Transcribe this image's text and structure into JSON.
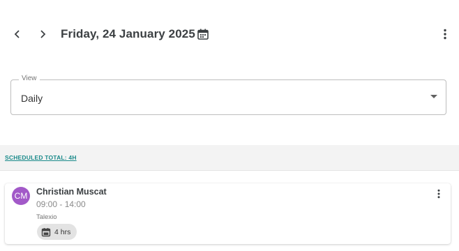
{
  "header": {
    "prev_icon": "chevron-left-icon",
    "next_icon": "chevron-right-icon",
    "date_title": "Friday, 24 January 2025",
    "calendar_icon": "calendar-icon",
    "more_icon": "more-vert-icon"
  },
  "view_select": {
    "label": "View",
    "value": "Daily",
    "caret_icon": "dropdown-caret-icon"
  },
  "summary": {
    "scheduled_total": "SCHEDULED TOTAL: 4H"
  },
  "shifts": [
    {
      "initials": "CM",
      "avatar_color": "#a259c8",
      "name": "Christian Muscat",
      "time": "09:00 - 14:00",
      "company": "Talexio",
      "hours": "4 hrs",
      "hours_icon": "calendar-icon",
      "more_icon": "more-vert-icon"
    }
  ],
  "colors": {
    "accent_link": "#1a8a8a",
    "header_text": "#3c4043",
    "summary_bg": "#f3f3f3",
    "chip_bg": "#e3e3e3"
  }
}
